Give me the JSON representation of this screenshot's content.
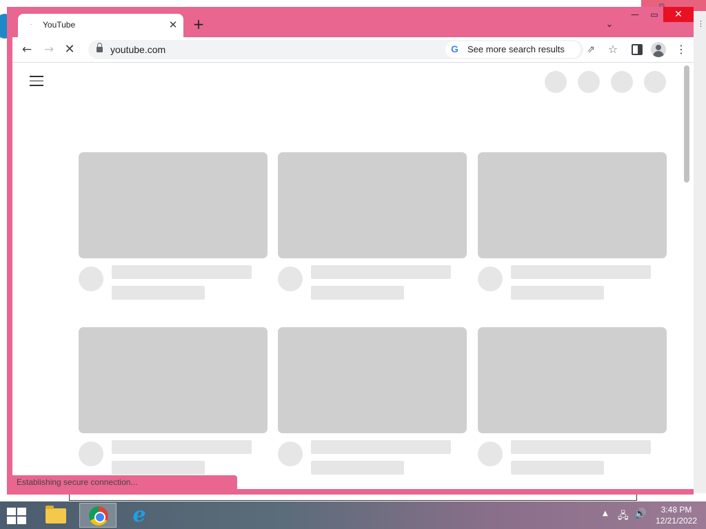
{
  "browser": {
    "tab_title": "YouTube",
    "tab_favicon": "·",
    "tab_close": "✕",
    "new_tab": "+",
    "tab_dropdown": "⌄",
    "window_controls": {
      "minimize": "—",
      "maximize": "▭",
      "close": "✕"
    }
  },
  "toolbar": {
    "back": "←",
    "forward": "→",
    "stop": "✕",
    "url": "youtube.com",
    "search_chip_label": "See more search results",
    "google_letter": "G",
    "share": "⇗",
    "star": "☆",
    "menu": "⋮"
  },
  "page": {
    "skeleton_cards": 6,
    "status_text": "Establishing secure connection..."
  },
  "taskbar": {
    "apps": [
      "file-explorer",
      "google-chrome",
      "internet-explorer"
    ],
    "ie_letter": "e",
    "tray_up": "▲",
    "tray_net": "🖧",
    "tray_vol": "🔊",
    "time": "3:48 PM",
    "date": "12/21/2022"
  },
  "desktop": {
    "bg_glyph_1": "⧉",
    "bg_glyph_2": "⋮"
  },
  "colors": {
    "window_frame": "#e8668f",
    "skeleton_thumb": "#cfcfcf",
    "skeleton_text": "#e6e6e6"
  }
}
